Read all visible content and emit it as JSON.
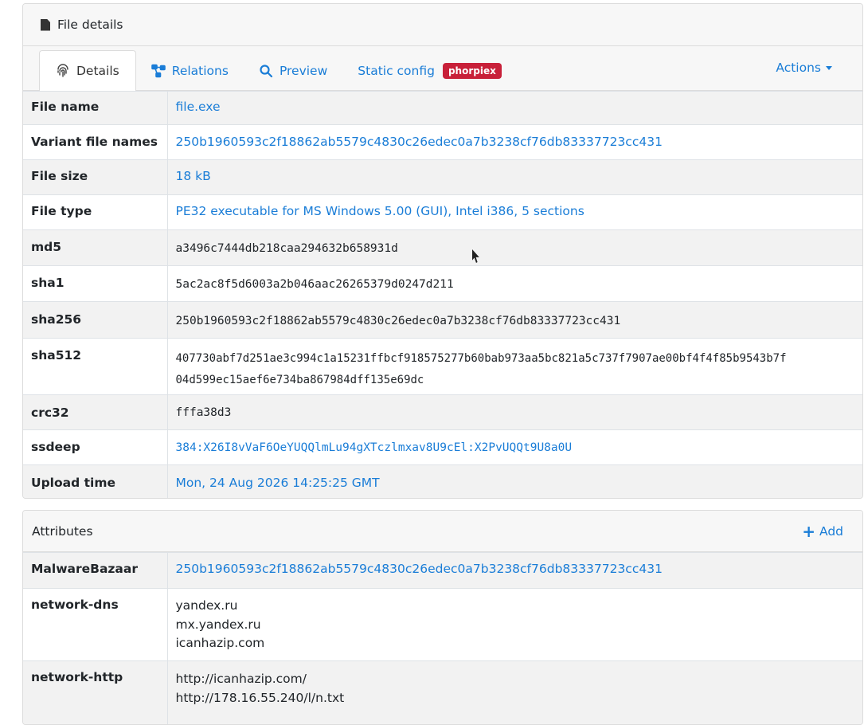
{
  "details": {
    "header_title": "File details",
    "tabs": [
      {
        "label": "Details",
        "icon": "fingerprint-icon"
      },
      {
        "label": "Relations",
        "icon": "relations-icon"
      },
      {
        "label": "Preview",
        "icon": "search-icon"
      },
      {
        "label": "Static config",
        "badge": "phorpiex"
      }
    ],
    "actions_label": "Actions",
    "rows": {
      "file_name": {
        "key": "File name",
        "value": "file.exe"
      },
      "variant_file_names": {
        "key": "Variant file names",
        "value": "250b1960593c2f18862ab5579c4830c26edec0a7b3238cf76db83337723cc431"
      },
      "file_size": {
        "key": "File size",
        "value": "18 kB"
      },
      "file_type": {
        "key": "File type",
        "value": "PE32 executable for MS Windows 5.00 (GUI), Intel i386, 5 sections"
      },
      "md5": {
        "key": "md5",
        "value": "a3496c7444db218caa294632b658931d"
      },
      "sha1": {
        "key": "sha1",
        "value": "5ac2ac8f5d6003a2b046aac26265379d0247d211"
      },
      "sha256": {
        "key": "sha256",
        "value": "250b1960593c2f18862ab5579c4830c26edec0a7b3238cf76db83337723cc431"
      },
      "sha512": {
        "key": "sha512",
        "line1": "407730abf7d251ae3c994c1a15231ffbcf918575277b60bab973aa5bc821a5c737f7907ae00bf4f4f85b9543b7f",
        "line2": "04d599ec15aef6e734ba867984dff135e69dc"
      },
      "crc32": {
        "key": "crc32",
        "value": "fffa38d3"
      },
      "ssdeep": {
        "key": "ssdeep",
        "value": "384:X26I8vVaF6OeYUQQlmLu94gXTczlmxav8U9cEl:X2PvUQQt9U8a0U"
      },
      "upload_time": {
        "key": "Upload time",
        "value": "Mon, 24 Aug 2026 14:25:25 GMT"
      }
    }
  },
  "attributes": {
    "header_title": "Attributes",
    "add_label": "Add",
    "malwarebazaar": {
      "key": "MalwareBazaar",
      "value": "250b1960593c2f18862ab5579c4830c26edec0a7b3238cf76db83337723cc431"
    },
    "network_dns": {
      "key": "network-dns",
      "values": [
        "yandex.ru",
        "mx.yandex.ru",
        "icanhazip.com"
      ]
    },
    "network_http": {
      "key": "network-http",
      "values": [
        "http://icanhazip.com/",
        "http://178.16.55.240/l/n.txt"
      ]
    }
  },
  "colors": {
    "link": "#1a7dd7",
    "badge": "#c82039",
    "header_bg": "#f7f7f7",
    "row_alt": "#f2f2f2"
  }
}
